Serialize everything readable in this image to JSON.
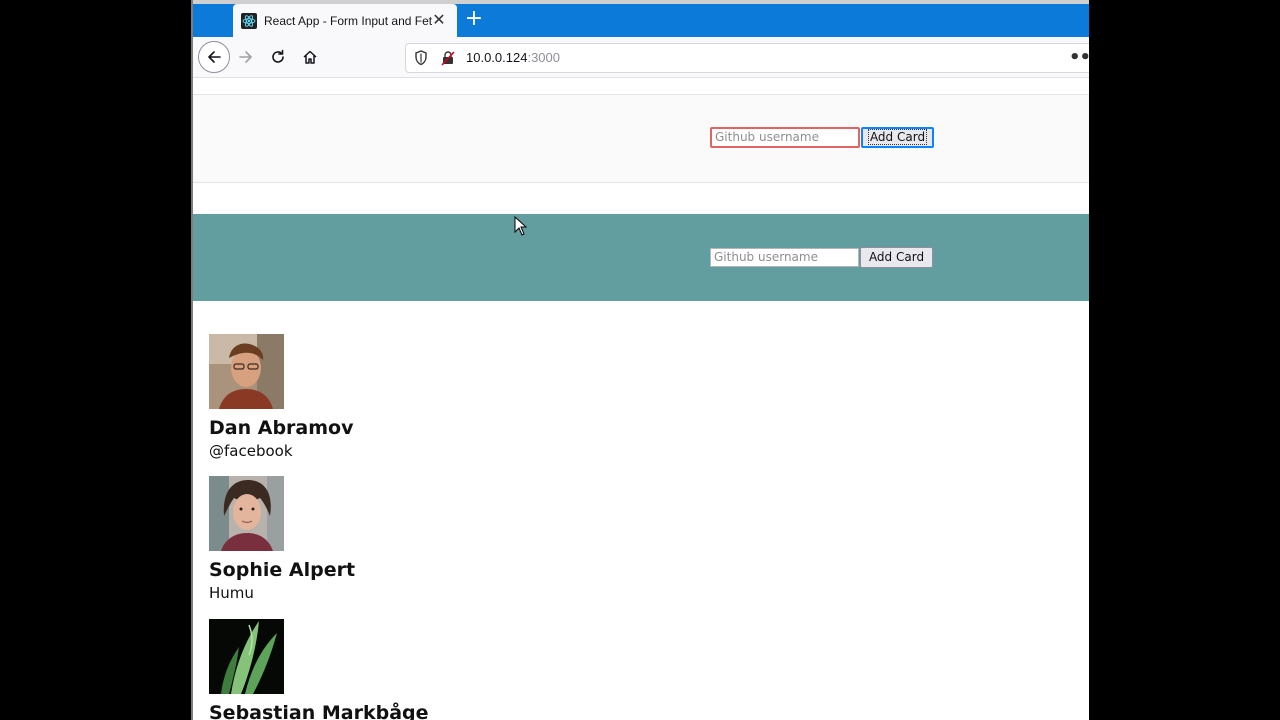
{
  "browser": {
    "tab_title": "React App - Form Input and Fet",
    "url_host": "10.0.0.124",
    "url_port": ":3000",
    "icons": [
      "react-icon",
      "close-icon",
      "plus-icon",
      "back-icon",
      "forward-icon",
      "reload-icon",
      "home-icon",
      "shield-icon",
      "insecure-icon",
      "more-icon"
    ]
  },
  "forms": [
    {
      "placeholder": "Github username",
      "button_label": "Add Card"
    },
    {
      "placeholder": "Github username",
      "button_label": "Add Card"
    }
  ],
  "cards": [
    {
      "name": "Dan Abramov",
      "company": "@facebook"
    },
    {
      "name": "Sophie Alpert",
      "company": "Humu"
    },
    {
      "name": "Sebastian Markbåge",
      "company": ""
    }
  ],
  "colors": {
    "tabbar": "#0c7ad9",
    "section2_bg": "#629da0",
    "input_focus_border": "#e06464",
    "button_focus_border": "#0a84ff"
  }
}
